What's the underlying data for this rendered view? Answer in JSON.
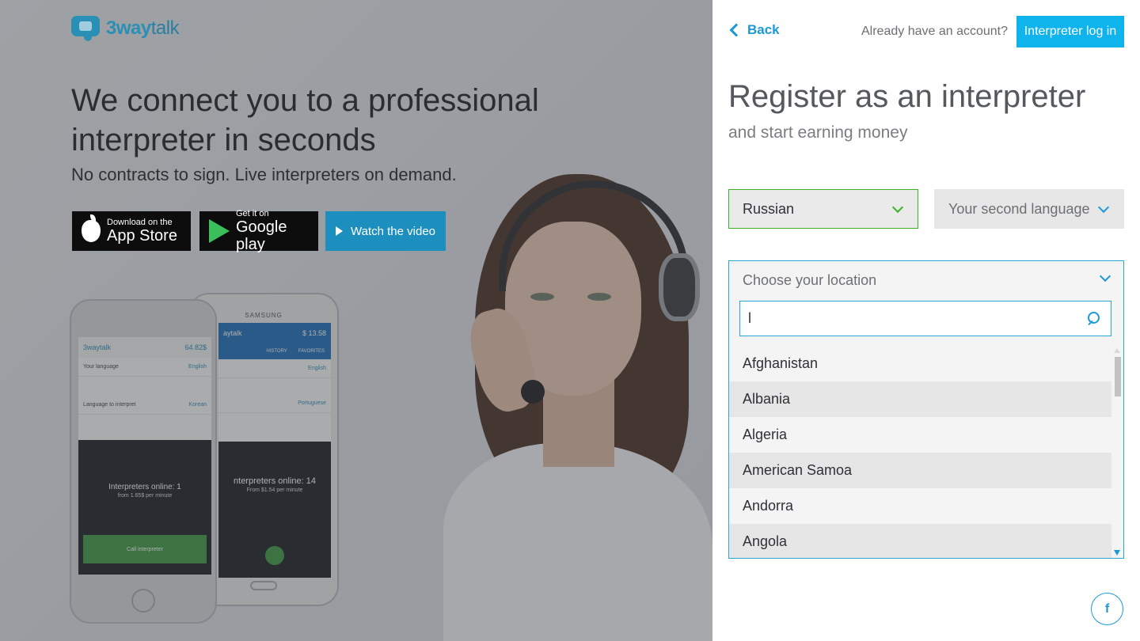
{
  "hero": {
    "logo_prefix": "3way",
    "logo_suffix": "talk",
    "title": "We connect you to a professional interpreter in seconds",
    "subtitle": "No contracts to sign. Live interpreters on demand.",
    "appstore": {
      "small": "Download on the",
      "big": "App Store"
    },
    "googleplay": {
      "small": "Get it on",
      "big": "Google play"
    },
    "video_label": "Watch the video"
  },
  "phone_left": {
    "brand": "3waytalk",
    "balance": "64.82$",
    "row1_label": "Your language",
    "row1_value": "English",
    "row2_label": "Language to interpret",
    "row2_value": "Korean",
    "online": "Interpreters online: 1",
    "price": "from 1.65$ per minute",
    "call": "Call interpreter"
  },
  "phone_right": {
    "brand_top": "SAMSUNG",
    "title": "aytalk",
    "balance": "$ 13.58",
    "tab_history": "HISTORY",
    "tab_favorites": "FAVORITES",
    "lang1": "English",
    "lang2": "Portuguese",
    "online": "nterpreters online: 14",
    "price": "From $1.54 per minute"
  },
  "panel": {
    "back": "Back",
    "already": "Already have an account?",
    "login": "Interpreter log in",
    "title": "Register as an interpreter",
    "subtitle": "and start earning money",
    "first_language": "Russian",
    "second_language_placeholder": "Your second language",
    "location_placeholder": "Choose your location",
    "search_value": "l",
    "countries": [
      "Afghanistan",
      "Albania",
      "Algeria",
      "American Samoa",
      "Andorra",
      "Angola"
    ],
    "facebook": "f"
  },
  "colors": {
    "accent": "#10b4ec",
    "link": "#1d9ad6",
    "selected_border": "#3fae29"
  }
}
